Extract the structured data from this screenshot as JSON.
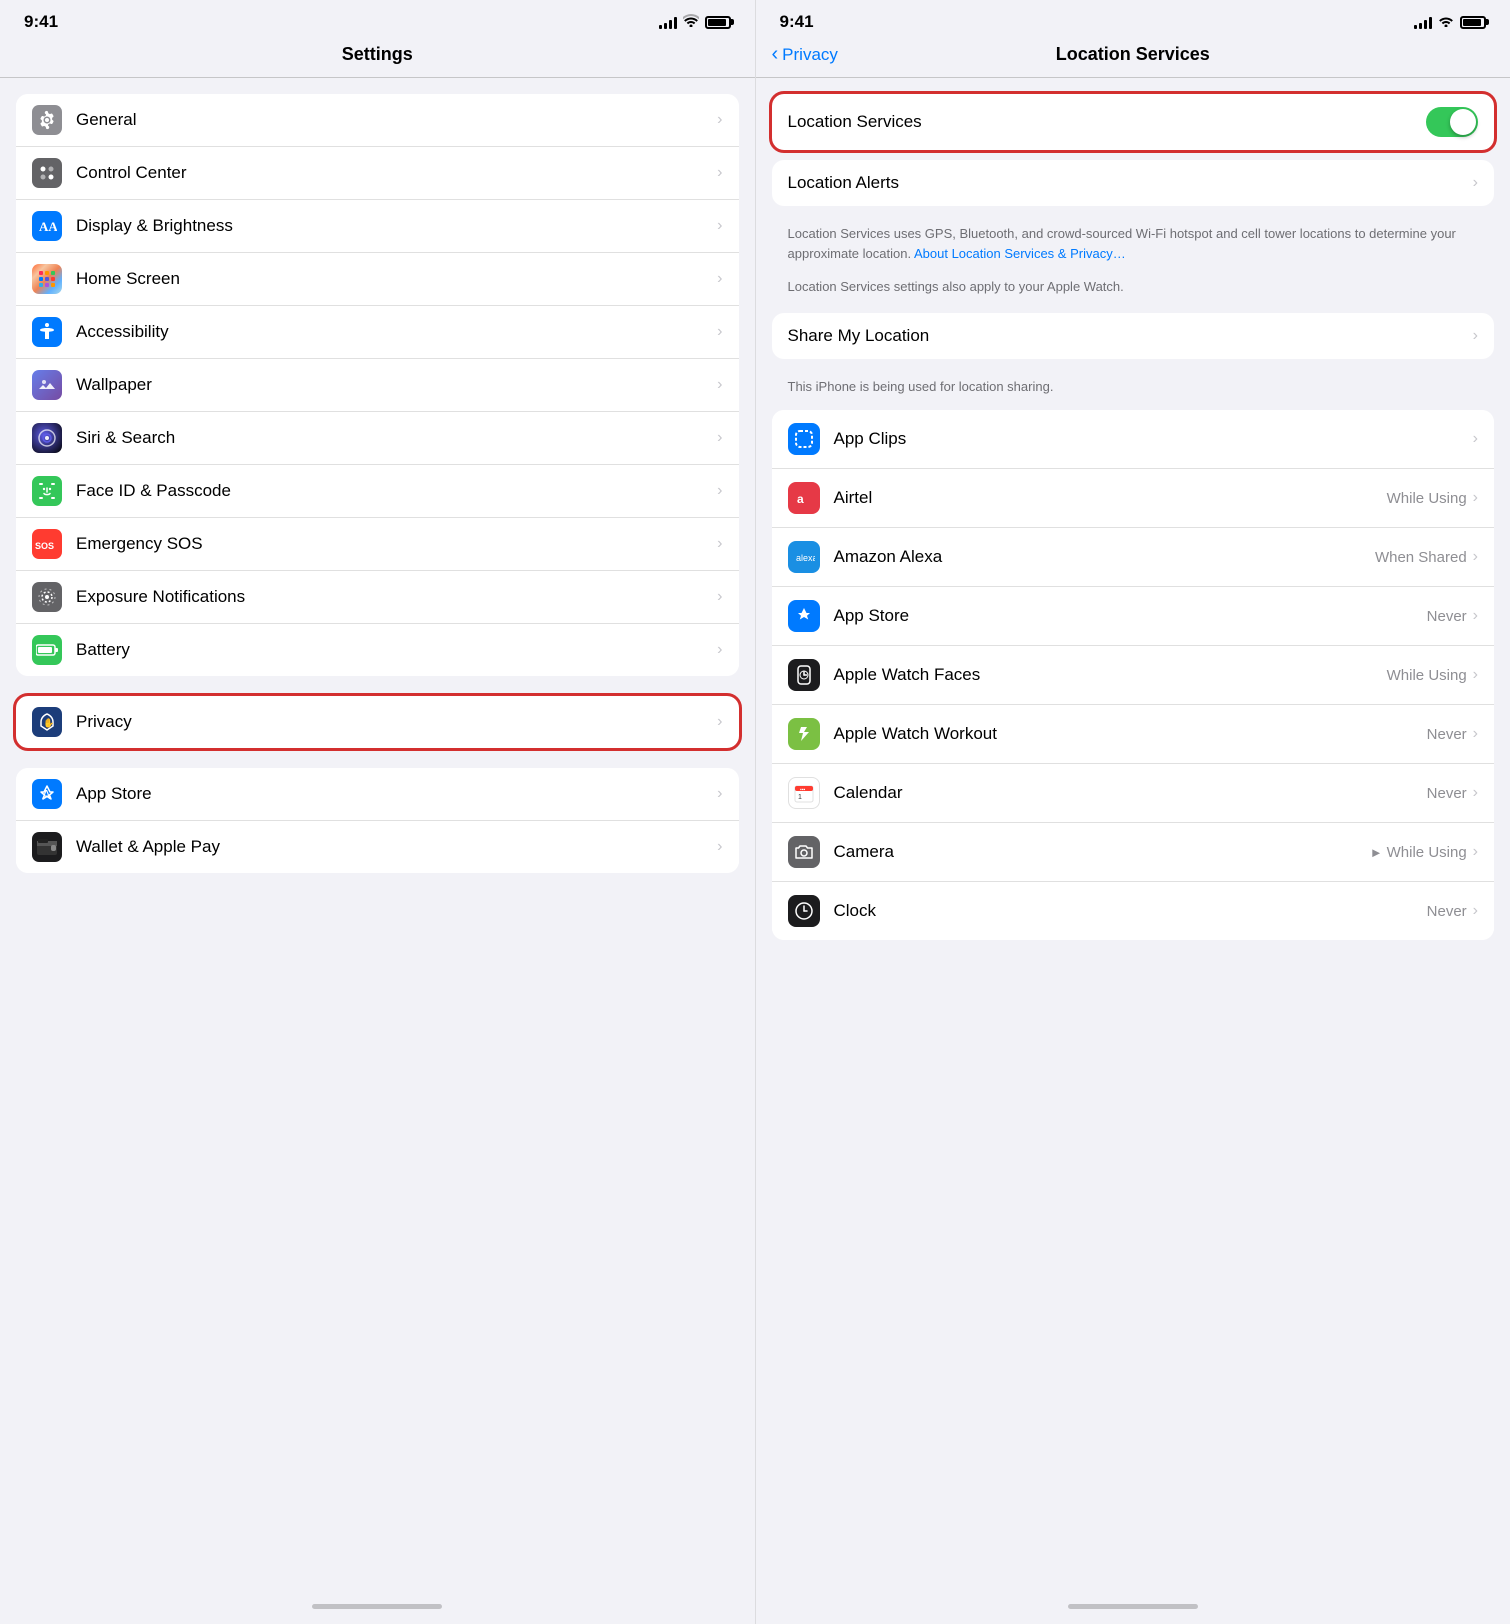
{
  "leftPanel": {
    "statusBar": {
      "time": "9:41",
      "signalBars": 4,
      "wifi": true,
      "battery": 90
    },
    "title": "Settings",
    "groups": [
      {
        "id": "group1",
        "highlighted": false,
        "items": [
          {
            "id": "general",
            "label": "General",
            "iconBg": "icon-gray",
            "icon": "⚙️"
          },
          {
            "id": "control-center",
            "label": "Control Center",
            "iconBg": "icon-dark-gray",
            "icon": "⊙"
          },
          {
            "id": "display-brightness",
            "label": "Display & Brightness",
            "iconBg": "icon-blue",
            "icon": "AA"
          },
          {
            "id": "home-screen",
            "label": "Home Screen",
            "iconBg": "icon-orange",
            "icon": "⊞"
          },
          {
            "id": "accessibility",
            "label": "Accessibility",
            "iconBg": "icon-blue",
            "icon": "♿"
          },
          {
            "id": "wallpaper",
            "label": "Wallpaper",
            "iconBg": "icon-purple",
            "icon": "✿"
          },
          {
            "id": "siri-search",
            "label": "Siri & Search",
            "iconBg": "icon-siri",
            "icon": "◎"
          },
          {
            "id": "face-id",
            "label": "Face ID & Passcode",
            "iconBg": "icon-green",
            "icon": "☺"
          },
          {
            "id": "emergency-sos",
            "label": "Emergency SOS",
            "iconBg": "icon-red",
            "icon": "SOS"
          },
          {
            "id": "exposure",
            "label": "Exposure Notifications",
            "iconBg": "icon-dark-gray",
            "icon": "◉"
          },
          {
            "id": "battery",
            "label": "Battery",
            "iconBg": "icon-green",
            "icon": "▬"
          }
        ]
      },
      {
        "id": "group2",
        "highlighted": true,
        "items": [
          {
            "id": "privacy",
            "label": "Privacy",
            "iconBg": "icon-dark-blue",
            "icon": "✋"
          }
        ]
      },
      {
        "id": "group3",
        "highlighted": false,
        "items": [
          {
            "id": "app-store",
            "label": "App Store",
            "iconBg": "icon-app-store",
            "icon": "🅐"
          },
          {
            "id": "wallet",
            "label": "Wallet & Apple Pay",
            "iconBg": "icon-wallet",
            "icon": "▤"
          }
        ]
      }
    ]
  },
  "rightPanel": {
    "statusBar": {
      "time": "9:41"
    },
    "backLabel": "Privacy",
    "title": "Location Services",
    "topGroup": {
      "highlighted": true,
      "toggleLabel": "Location Services",
      "toggleOn": true
    },
    "alertsRow": {
      "label": "Location Alerts"
    },
    "description": "Location Services uses GPS, Bluetooth, and crowd-sourced Wi-Fi hotspot and cell tower locations to determine your approximate location.",
    "descriptionLink": "About Location Services & Privacy…",
    "watchNote": "Location Services settings also apply to your Apple Watch.",
    "shareGroup": {
      "label": "Share My Location",
      "note": "This iPhone is being used for location sharing."
    },
    "apps": [
      {
        "id": "app-clips",
        "label": "App Clips",
        "value": "",
        "iconBg": "#007aff",
        "iconType": "app-clips",
        "hasArrow": false
      },
      {
        "id": "airtel",
        "label": "Airtel",
        "value": "While Using",
        "iconBg": "#e63946",
        "iconType": "airtel",
        "hasArrow": false
      },
      {
        "id": "amazon-alexa",
        "label": "Amazon Alexa",
        "value": "When Shared",
        "iconBg": "#1a8fe3",
        "iconType": "alexa",
        "hasArrow": false
      },
      {
        "id": "app-store",
        "label": "App Store",
        "value": "Never",
        "iconBg": "#007aff",
        "iconType": "app-store",
        "hasArrow": false
      },
      {
        "id": "apple-watch-faces",
        "label": "Apple Watch Faces",
        "value": "While Using",
        "iconBg": "#1c1c1e",
        "iconType": "watch",
        "hasArrow": false
      },
      {
        "id": "apple-watch-workout",
        "label": "Apple Watch Workout",
        "value": "Never",
        "iconBg": "#7bc043",
        "iconType": "workout",
        "hasArrow": false
      },
      {
        "id": "calendar",
        "label": "Calendar",
        "value": "Never",
        "iconBg": "#fff",
        "iconType": "calendar",
        "hasArrow": false
      },
      {
        "id": "camera",
        "label": "Camera",
        "value": "While Using",
        "iconBg": "#636366",
        "iconType": "camera",
        "hasArrow": false,
        "hasLocationArrow": true
      },
      {
        "id": "clock",
        "label": "Clock",
        "value": "Never",
        "iconBg": "#fff",
        "iconType": "clock",
        "hasArrow": false
      }
    ]
  }
}
